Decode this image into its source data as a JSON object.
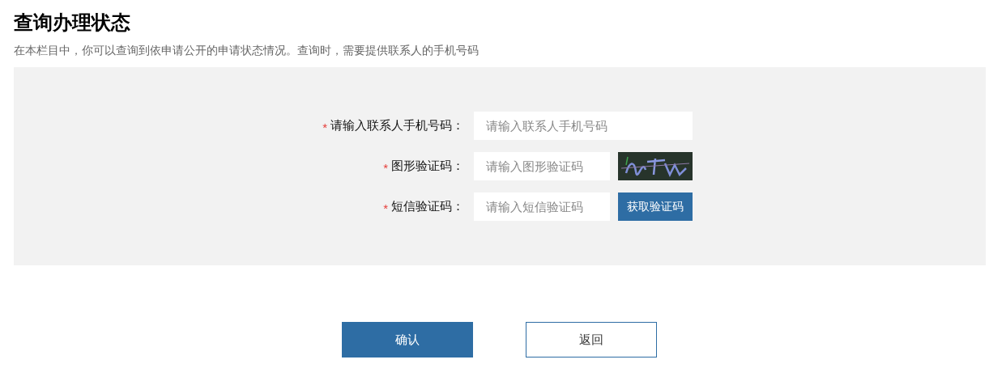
{
  "title": "查询办理状态",
  "description": "在本栏目中，你可以查询到依申请公开的申请状态情况。查询时，需要提供联系人的手机号码",
  "form": {
    "fields": [
      {
        "kind": "plain",
        "required_mark": "*",
        "label": "请输入联系人手机号码：",
        "placeholder": "请输入联系人手机号码"
      },
      {
        "kind": "captcha",
        "required_mark": "*",
        "label": "图形验证码：",
        "placeholder": "请输入图形验证码"
      },
      {
        "kind": "sms",
        "required_mark": "*",
        "label": "短信验证码：",
        "placeholder": "请输入短信验证码",
        "button": "获取验证码"
      }
    ]
  },
  "buttons": {
    "confirm": "确认",
    "back": "返回"
  }
}
